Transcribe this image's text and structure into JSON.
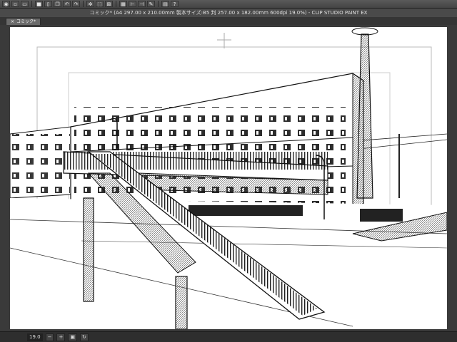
{
  "window": {
    "title": "コミック* (A4 297.00 x 210.00mm 製本サイズ:B5 判 257.00 x 182.00mm 600dpi 19.0%)  - CLIP STUDIO PAINT EX"
  },
  "toolbar": {
    "buttons": [
      {
        "icon": "eye-icon",
        "glyph": "◉"
      },
      {
        "icon": "new-document-icon",
        "glyph": "▫"
      },
      {
        "icon": "open-folder-icon",
        "glyph": "▭"
      },
      {
        "icon": "save-icon",
        "glyph": "■"
      },
      {
        "icon": "page-icon",
        "glyph": "▯"
      },
      {
        "icon": "copy-icon",
        "glyph": "❐"
      },
      {
        "icon": "undo-icon",
        "glyph": "↶"
      },
      {
        "icon": "redo-icon",
        "glyph": "↷"
      },
      {
        "icon": "settings-icon",
        "glyph": "✲"
      },
      {
        "icon": "transform-icon",
        "glyph": "⬚"
      },
      {
        "icon": "selection-icon",
        "glyph": "⊠"
      },
      {
        "icon": "grid-icon",
        "glyph": "▦"
      },
      {
        "icon": "ruler-icon",
        "glyph": "⊢"
      },
      {
        "icon": "snap-icon",
        "glyph": "⊣"
      },
      {
        "icon": "pen-icon",
        "glyph": "✎"
      },
      {
        "icon": "layer-icon",
        "glyph": "▤"
      },
      {
        "icon": "help-icon",
        "glyph": "?"
      }
    ]
  },
  "tabs": [
    {
      "label": "コミック*",
      "close": "×"
    }
  ],
  "status": {
    "zoom": "19.0"
  }
}
